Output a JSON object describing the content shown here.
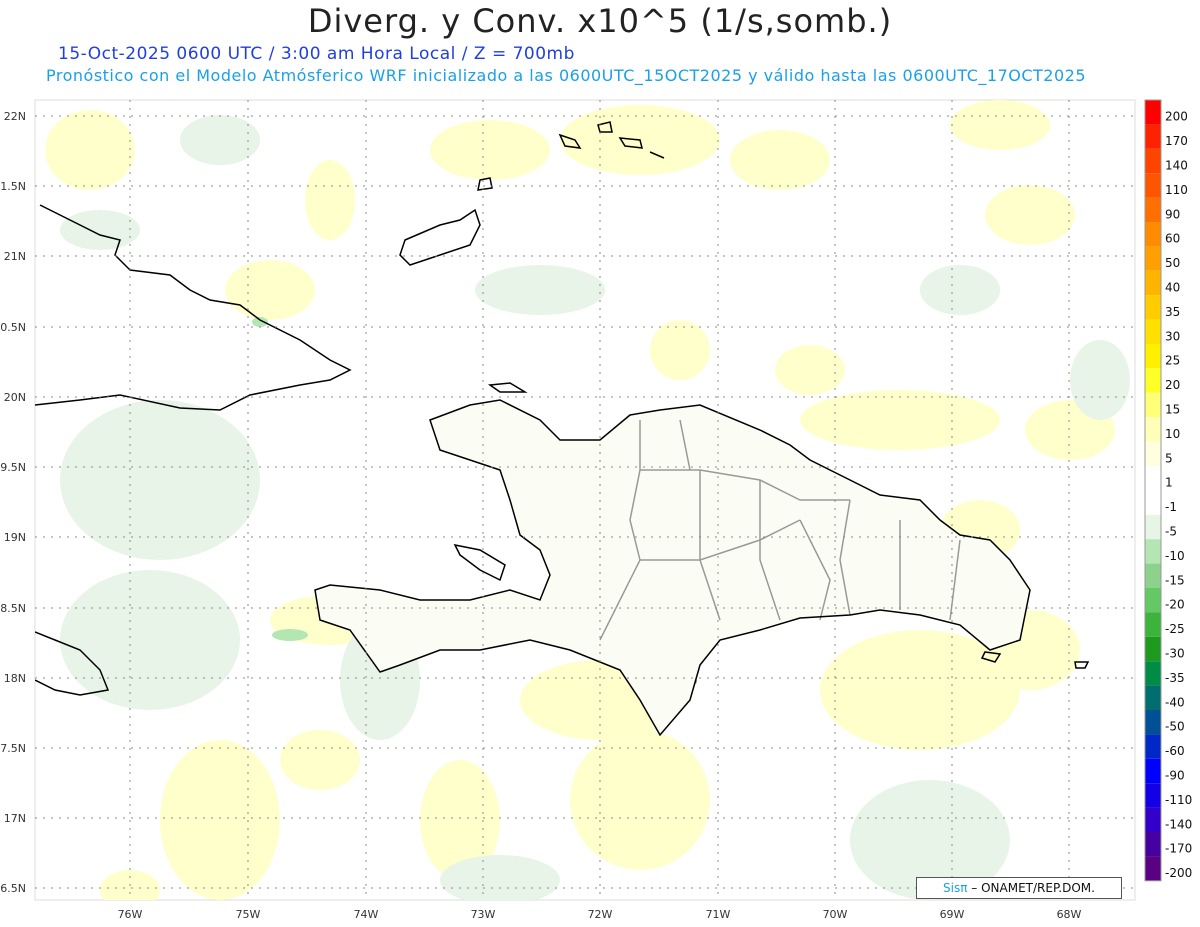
{
  "header": {
    "title": "Diverg. y Conv. x10^5 (1/s,somb.)",
    "subtitle_time": "15-Oct-2025  0600 UTC / 3:00 am Hora Local / Z = 700mb",
    "subtitle_model": "Pronóstico con el Modelo Atmósferico WRF inicializado a las 0600UTC_15OCT2025 y válido hasta las  0600UTC_17OCT2025"
  },
  "axes": {
    "lat_labels": [
      "22N",
      "1.5N",
      "21N",
      "0.5N",
      "20N",
      "9.5N",
      "19N",
      "8.5N",
      "18N",
      "7.5N",
      "17N",
      "6.5N"
    ],
    "lon_labels": [
      "76W",
      "75W",
      "74W",
      "73W",
      "72W",
      "71W",
      "70W",
      "69W",
      "68W"
    ]
  },
  "legend": {
    "labels": [
      "200",
      "170",
      "140",
      "110",
      "90",
      "60",
      "50",
      "40",
      "35",
      "30",
      "25",
      "20",
      "15",
      "10",
      "5",
      "1",
      "-1",
      "-5",
      "-10",
      "-15",
      "-20",
      "-25",
      "-30",
      "-35",
      "-40",
      "-50",
      "-60",
      "-90",
      "-110",
      "-140",
      "-170",
      "-200"
    ],
    "colors": [
      "#ff0000",
      "#ff2200",
      "#ff4400",
      "#ff5500",
      "#ff7000",
      "#ff8c00",
      "#ffa000",
      "#ffb400",
      "#ffcc00",
      "#ffe000",
      "#fff000",
      "#ffff28",
      "#ffff78",
      "#ffffb8",
      "#ffffe0",
      "#ffffff",
      "#ffffff",
      "#e6f5e6",
      "#b4e6b4",
      "#8cd28c",
      "#64c864",
      "#3cb43c",
      "#1e9b1e",
      "#008c46",
      "#006e6e",
      "#005096",
      "#0028c8",
      "#0000ff",
      "#1400e6",
      "#3200c8",
      "#4600a0",
      "#5a0082"
    ]
  },
  "credit": {
    "logo_text": "Sisπ",
    "text": "– ONAMET/REP.DOM."
  },
  "colors": {
    "divergence_fill": "#ffffcc",
    "convergence_fill": "#e8f4e8",
    "strong_convergence": "#5cb85c",
    "strong_divergence": "#ffee44",
    "coastline": "#000000",
    "provinces": "#999999",
    "grid": "#888888"
  }
}
